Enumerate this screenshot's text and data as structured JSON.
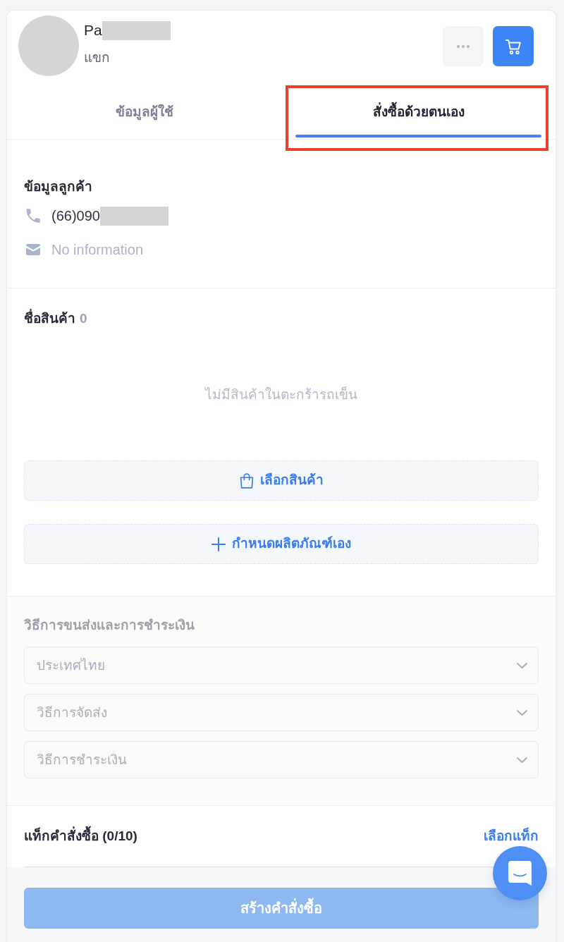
{
  "user": {
    "name": "Pa",
    "name_redacted": true,
    "role": "แขก"
  },
  "tabs": [
    {
      "label": "ข้อมูลผู้ใช้",
      "selected": false,
      "highlighted": false
    },
    {
      "label": "สั่งซื้อด้วยตนเอง",
      "selected": true,
      "highlighted": true
    }
  ],
  "customer": {
    "title": "ข้อมูลลูกค้า",
    "contacts": [
      {
        "kind": "phone",
        "value": "(66)090",
        "redacted": true,
        "empty": false
      },
      {
        "kind": "email",
        "value": "No information",
        "redacted": false,
        "empty": true
      }
    ]
  },
  "products": {
    "title": "ชื่อสินค้า",
    "count": "0",
    "empty_message": "ไม่มีสินค้าในตะกร้ารถเข็น",
    "buttons": [
      {
        "kind": "select",
        "label": "เลือกสินค้า"
      },
      {
        "kind": "custom",
        "label": "กำหนดผลิตภัณฑ์เอง"
      }
    ]
  },
  "shipping_payment": {
    "title": "วิธีการขนส่งและการชำระเงิน",
    "disabled": true,
    "selects": [
      {
        "placeholder": "ประเทศไทย"
      },
      {
        "placeholder": "วิธีการจัดส่ง"
      },
      {
        "placeholder": "วิธีการชำระเงิน"
      }
    ]
  },
  "tags": {
    "title": "แท็กคำสั่งซื้อ (0/10)",
    "action": "เลือกแท็ก"
  },
  "footer": {
    "submit": {
      "label": "สร้างคำสั่งซื้อ",
      "disabled": true
    }
  }
}
